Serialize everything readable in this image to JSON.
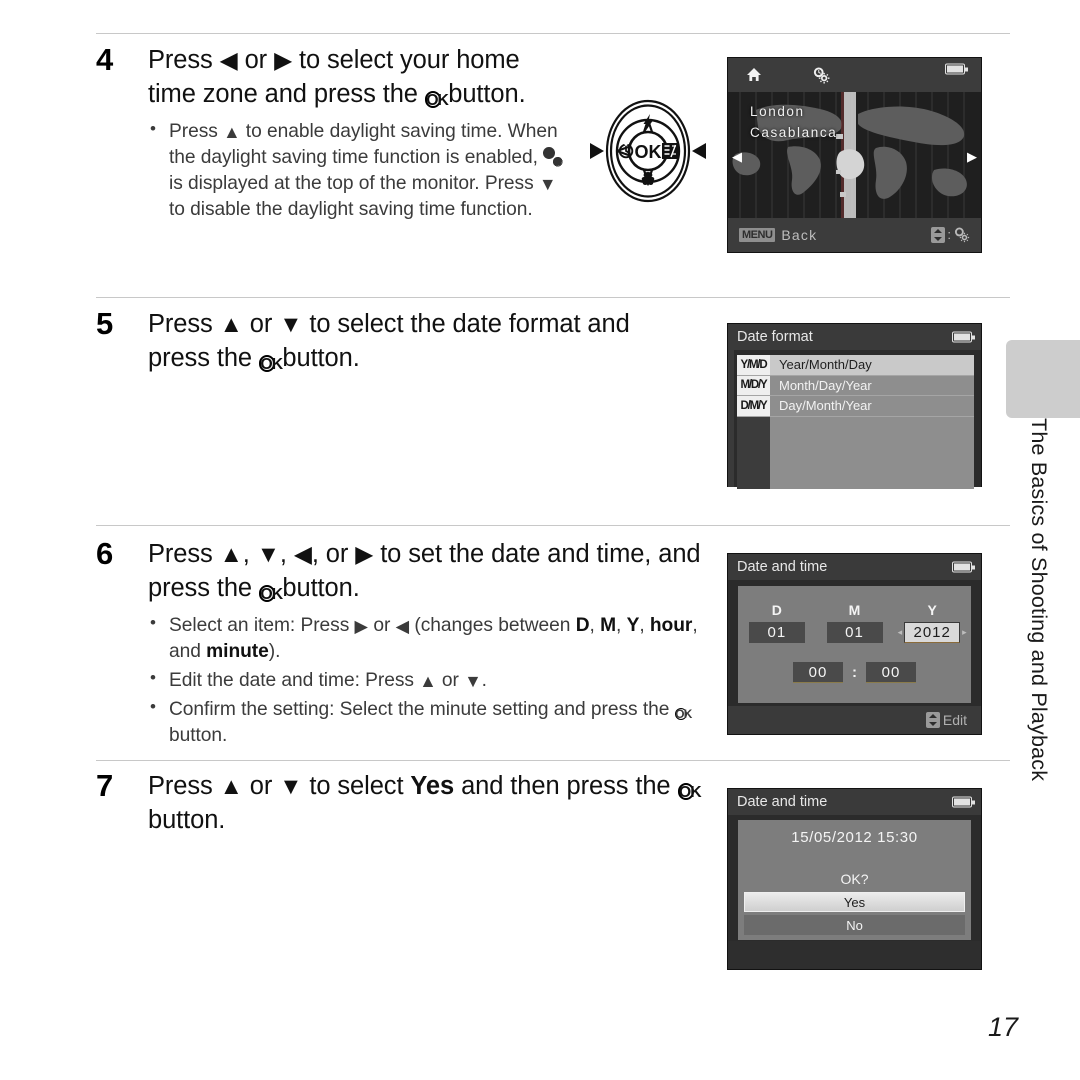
{
  "document": {
    "page_number": "17",
    "side_tab_label": "The Basics of Shooting and Playback"
  },
  "steps": [
    {
      "number": "4",
      "heading_parts": [
        "Press ",
        "◀",
        " or ",
        "▶",
        " to select your home time zone and press the ",
        "OK",
        " button."
      ],
      "bullets": [
        "Press ▲ to enable daylight saving time. When the daylight saving time function is enabled, ☀ is displayed at the top of the monitor. Press ▼ to disable the daylight saving time function."
      ]
    },
    {
      "number": "5",
      "heading_parts": [
        "Press ",
        "▲",
        " or ",
        "▼",
        " to select the date format and press the ",
        "OK",
        " button."
      ],
      "bullets": []
    },
    {
      "number": "6",
      "heading_parts": [
        "Press ",
        "▲",
        ", ",
        "▼",
        ", ",
        "◀",
        ", or ",
        "▶",
        " to set the date and time, and press the ",
        "OK",
        " button."
      ],
      "bullets": [
        "Select an item: Press ▶ or ◀ (changes between D, M, Y, hour, and minute).",
        "Edit the date and time: Press ▲ or ▼.",
        "Confirm the setting: Select the minute setting and press the OK button."
      ]
    },
    {
      "number": "7",
      "heading_parts": [
        "Press ",
        "▲",
        " or ",
        "▼",
        " to select ",
        "Yes",
        " and then press the ",
        "OK",
        " button."
      ],
      "bullets": []
    }
  ],
  "step4_heading": {
    "t1": "Press ",
    "t2": " or ",
    "t3": " to select your home time zone and press the ",
    "t4": " button."
  },
  "step5_heading": {
    "t1": "Press ",
    "t2": " or ",
    "t3": " to select the date format and press the ",
    "t4": " button."
  },
  "step6_heading": {
    "t1": "Press ",
    "t2": ", ",
    "t3": ", ",
    "t4": ", or ",
    "t5": " to set the date and time, and press the ",
    "t6": " button."
  },
  "step7_heading": {
    "t1": "Press ",
    "t2": " or ",
    "t3": " to select ",
    "bold": "Yes",
    "t4": " and then press the ",
    "t5": " button."
  },
  "step4_bullet": {
    "a": "Press ",
    "b": " to enable daylight saving time. When the daylight saving time function is enabled, ",
    "c": " is displayed at the top of the monitor. Press ",
    "d": " to disable the daylight saving time function."
  },
  "step6_bullets": {
    "b1a": "Select an item: Press ",
    "b1b": " or ",
    "b1c": " (changes between ",
    "b1d": "D",
    "b1e": ", ",
    "b1f": "M",
    "b1g": ", ",
    "b1h": "Y",
    "b1i": ", ",
    "b1j": "hour",
    "b1k": ", and ",
    "b1l": "minute",
    "b1m": ").",
    "b2a": "Edit the date and time: Press ",
    "b2b": " or ",
    "b2c": ".",
    "b3a": "Confirm the setting: Select the minute setting and press the ",
    "b3b": " button."
  },
  "screens": {
    "world_map": {
      "title_icons": [
        "home-icon",
        "daylight-saving-icon",
        "battery-icon"
      ],
      "cities": [
        "London",
        "Casablanca"
      ],
      "menu_badge": "MENU",
      "back_label": "Back",
      "left_arrow": "◀",
      "right_arrow": "▶",
      "colon": ":"
    },
    "date_format": {
      "title": "Date format",
      "rows": [
        {
          "icon": "Y/M/D",
          "label": "Year/Month/Day",
          "selected": true
        },
        {
          "icon": "M/D/Y",
          "label": "Month/Day/Year",
          "selected": false
        },
        {
          "icon": "D/M/Y",
          "label": "Day/Month/Year",
          "selected": false
        }
      ]
    },
    "date_time": {
      "title": "Date and time",
      "col_labels": [
        "D",
        "M",
        "Y"
      ],
      "day": "01",
      "month": "01",
      "year": "2012",
      "hour": "00",
      "minute": "00",
      "time_separator": ":",
      "edit_label": "Edit",
      "left_caret": "◂",
      "right_caret": "▸"
    },
    "confirm": {
      "title": "Date and time",
      "datetime": "15/05/2012  15:30",
      "question": "OK?",
      "yes_label": "Yes",
      "no_label": "No"
    }
  },
  "multi_selector": {
    "center_label": "OK",
    "icons": [
      "flash-icon",
      "self-timer-icon",
      "exposure-compensation-icon",
      "macro-icon"
    ],
    "left_arrow": "◀",
    "right_arrow": "▶"
  },
  "colors": {
    "screen_bg": "#2e2e2e",
    "screen_title_bg": "#3a3a3a",
    "panel_gray": "#8e8e8e",
    "highlight": "#c9c9c9",
    "tab_gray": "#cdcdcd",
    "rule": "#c8c8c8"
  }
}
